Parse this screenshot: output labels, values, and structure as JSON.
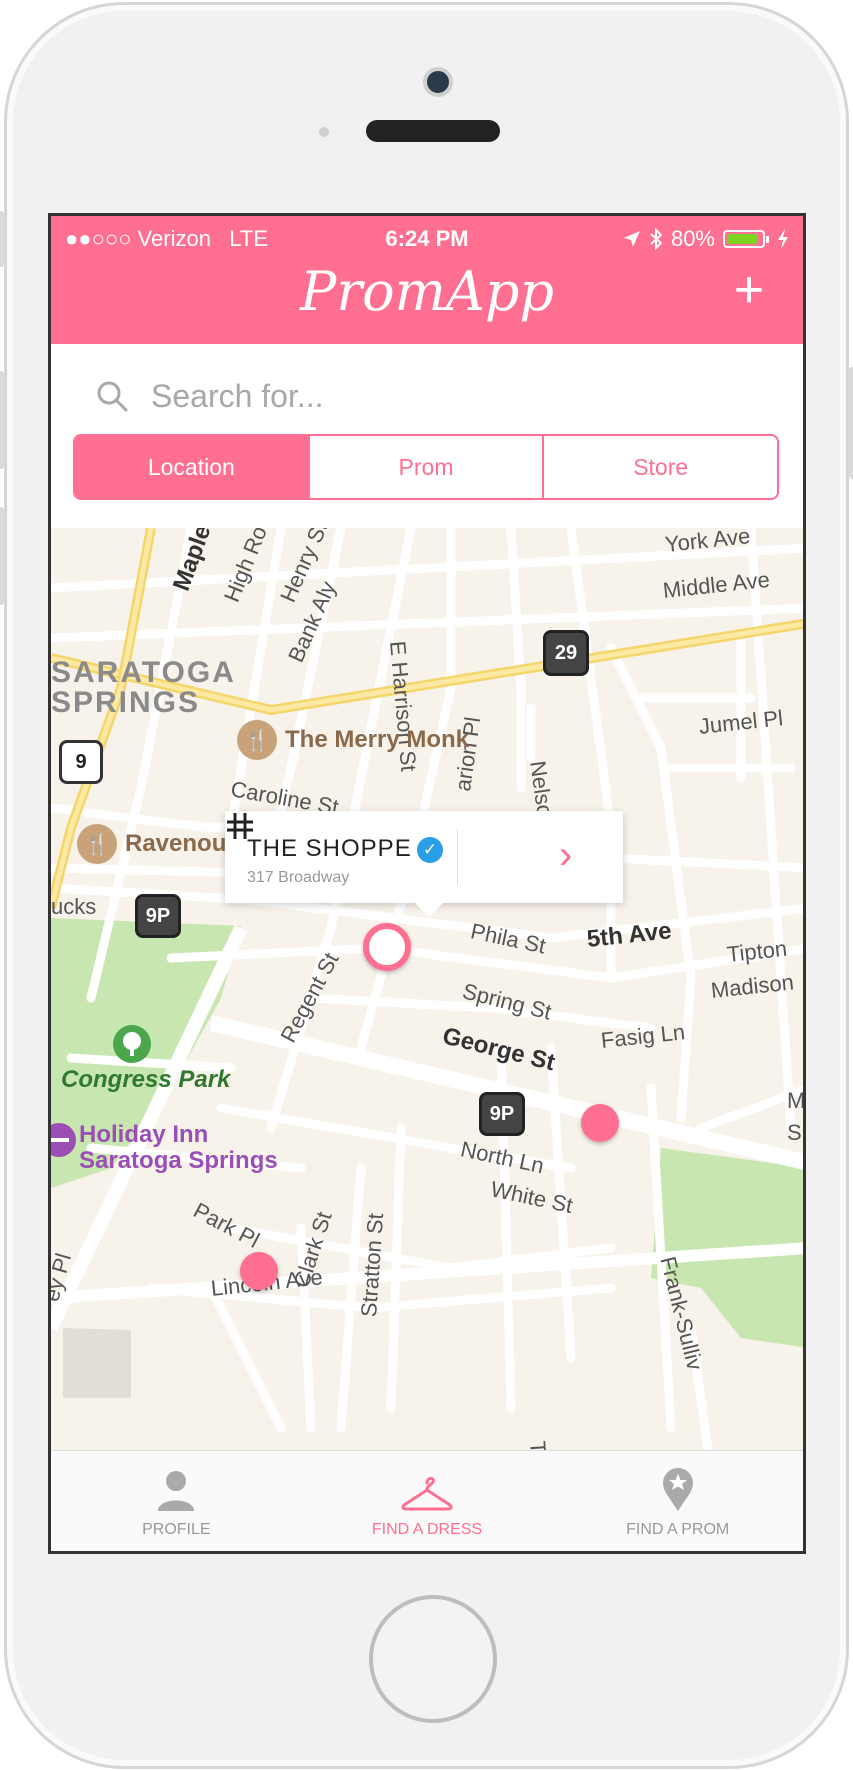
{
  "status_bar": {
    "carrier": "●●○○○ Verizon",
    "network": "LTE",
    "time": "6:24 PM",
    "battery": "80%"
  },
  "header": {
    "title": "PromApp",
    "add_label": "+"
  },
  "search": {
    "placeholder": "Search for..."
  },
  "segments": [
    {
      "label": "Location",
      "selected": true
    },
    {
      "label": "Prom",
      "selected": false
    },
    {
      "label": "Store",
      "selected": false
    }
  ],
  "map": {
    "town": [
      "SARATOGA",
      "SPRINGS"
    ],
    "streets": {
      "maple": "Maple Av",
      "high_rock": "High Rock",
      "henry": "Henry St",
      "bank_aly": "Bank Aly",
      "e_harrison": "E Harrison St",
      "york": "York Ave",
      "middle": "Middle Ave",
      "jumel": "Jumel Pl",
      "nelson": "Nelson Ave",
      "marion": "arion Pl",
      "caroline": "Caroline St",
      "phila": "Phila St",
      "fifth": "5th Ave",
      "tipton": "Tipton",
      "madison": "Madison",
      "spring": "Spring St",
      "regent": "Regent St",
      "george": "George St",
      "fasig": "Fasig Ln",
      "north": "North Ln",
      "white": "White St",
      "park": "Park Pl",
      "clark": "Clark St",
      "stratton": "Stratton St",
      "lincoln": "Lincoln Ave",
      "frank": "Frank-Sulliv",
      "putnam": "ucks",
      "mi": "Mi",
      "sn": "Sn",
      "tr": "Tr",
      "ey": "ey Pl"
    },
    "shields": {
      "rt29": "29",
      "rt9": "9",
      "rt9p_a": "9P",
      "rt9p_b": "9P"
    },
    "pois": {
      "merry_monk": "The Merry Monk",
      "ravenous": "Ravenou",
      "park": "Congress Park",
      "hotel_1": "Holiday Inn",
      "hotel_2": "Saratoga Springs"
    },
    "callout": {
      "name": "THE SHOPPE",
      "address": "317 Broadway"
    }
  },
  "tabs": [
    {
      "label": "PROFILE",
      "icon": "person-icon",
      "active": false
    },
    {
      "label": "FIND A DRESS",
      "icon": "hanger-icon",
      "active": true
    },
    {
      "label": "FIND A PROM",
      "icon": "star-pin-icon",
      "active": false
    }
  ],
  "colors": {
    "accent": "#ff6f91",
    "battery": "#7ed321",
    "verified": "#2a9fe8",
    "park": "#c8e6b0"
  }
}
